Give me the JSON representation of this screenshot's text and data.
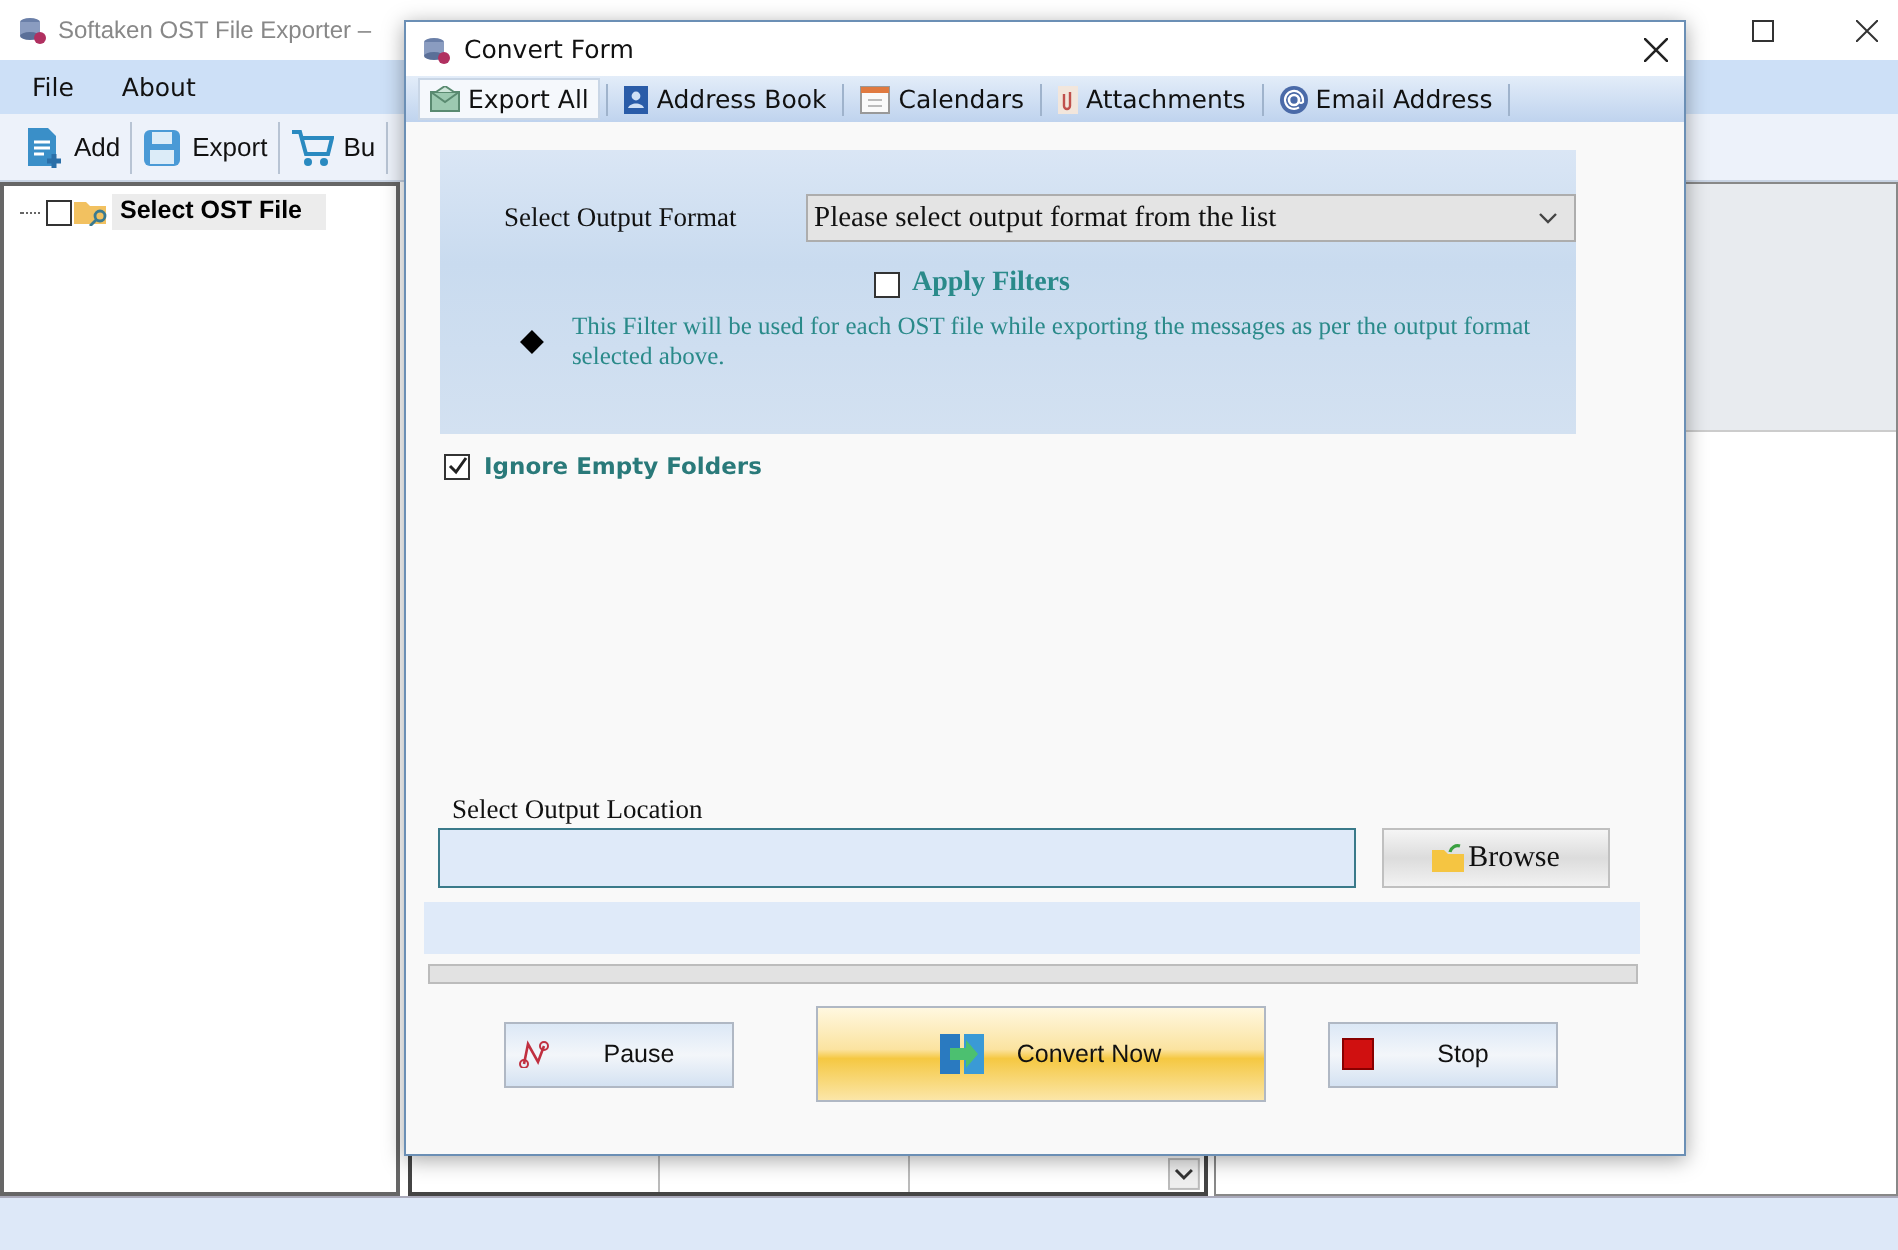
{
  "main_window": {
    "title": "Softaken OST File Exporter –",
    "menu": [
      "File",
      "About"
    ],
    "toolbar": [
      {
        "label": "Add",
        "kind": "add"
      },
      {
        "label": "Export",
        "kind": "save"
      },
      {
        "label": "Bu",
        "kind": "cart"
      }
    ],
    "tree": [
      {
        "label": "Select OST File",
        "checked": false
      }
    ]
  },
  "dialog": {
    "title": "Convert Form",
    "tabs": [
      {
        "label": "Export All",
        "selected": true,
        "kind": "mail"
      },
      {
        "label": "Address Book",
        "selected": false,
        "kind": "book"
      },
      {
        "label": "Calendars",
        "selected": false,
        "kind": "calendar"
      },
      {
        "label": "Attachments",
        "selected": false,
        "kind": "clip"
      },
      {
        "label": "Email Address",
        "selected": false,
        "kind": "at"
      }
    ],
    "output_format": {
      "label": "Select Output Format",
      "value": "Please select output format from the list"
    },
    "apply_filters": {
      "label": "Apply Filters",
      "checked": false
    },
    "filter_note": "This Filter will be used for each OST file while exporting the messages as per the output format selected above.",
    "ignore_empty_folders": {
      "label": "Ignore Empty Folders",
      "checked": true
    },
    "output_location": {
      "label": "Select Output Location"
    },
    "browse_button": "Browse",
    "progress": {
      "level": 0
    },
    "buttons": [
      {
        "label": "Pause",
        "kind": "pause"
      },
      {
        "label": "Convert Now",
        "kind": "convert"
      },
      {
        "label": "Stop",
        "kind": "stop"
      }
    ]
  }
}
